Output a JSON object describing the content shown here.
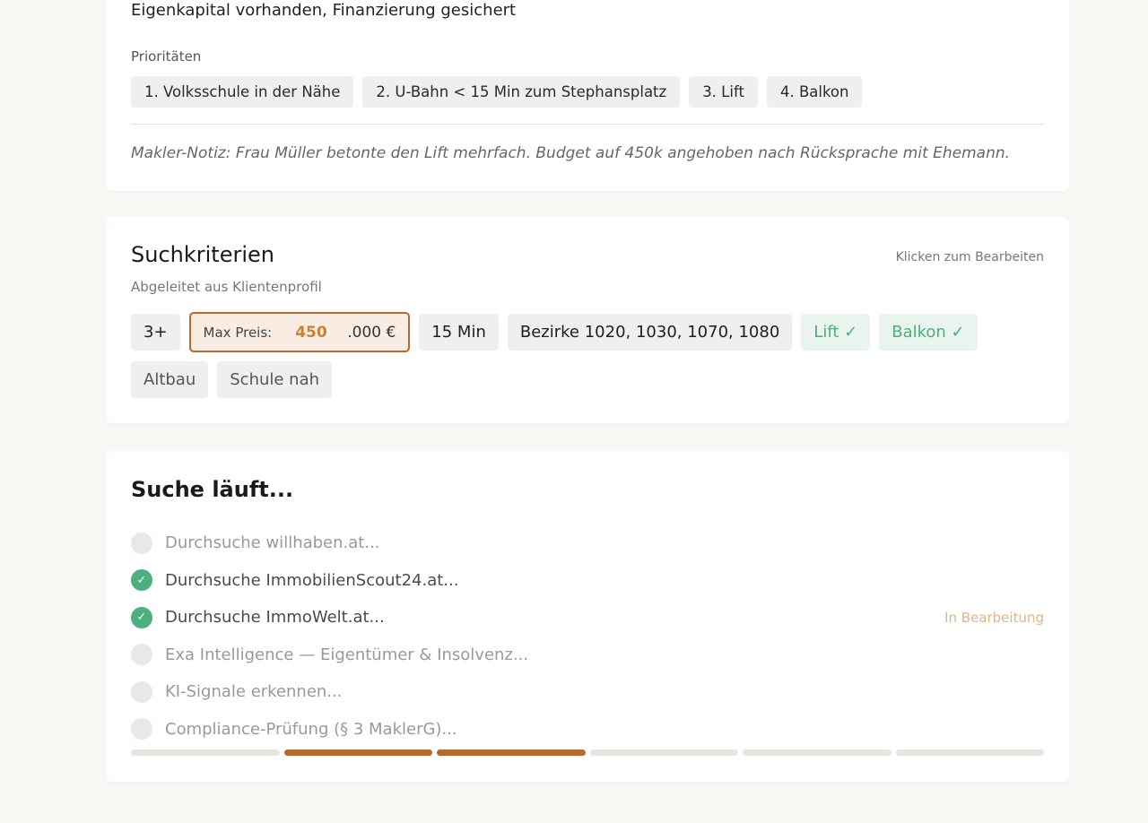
{
  "profile": {
    "finance_line": "Eigenkapital vorhanden, Finanzierung gesichert",
    "priorities_label": "Prioritäten",
    "priorities": [
      "1. Volksschule in der Nähe",
      "2. U-Bahn < 15 Min zum Stephansplatz",
      "3. Lift",
      "4. Balkon"
    ],
    "note": "Makler-Notiz: Frau Müller betonte den Lift mehrfach. Budget auf 450k angehoben nach Rücksprache mit Ehemann."
  },
  "criteria": {
    "title": "Suchkriterien",
    "edit_hint": "Klicken zum Bearbeiten",
    "subtitle": "Abgeleitet aus Klientenprofil",
    "rooms": "3+",
    "price_label": "Max Preis:",
    "price_value": "450",
    "price_suffix": ".000 €",
    "commute": "15 Min",
    "districts": "Bezirke 1020, 1030, 1070, 1080",
    "lift": "Lift ✓",
    "balcony": "Balkon ✓",
    "altbau": "Altbau",
    "school": "Schule nah",
    "colors": {
      "accent": "#b86a2c",
      "success": "#4caf7d"
    }
  },
  "search": {
    "title": "Suche läuft...",
    "steps": [
      {
        "label": "Durchsuche willhaben.at...",
        "done": false,
        "status": ""
      },
      {
        "label": "Durchsuche ImmobilienScout24.at...",
        "done": true,
        "status": ""
      },
      {
        "label": "Durchsuche ImmoWelt.at...",
        "done": true,
        "status": "In Bearbeitung"
      },
      {
        "label": "Exa Intelligence — Eigentümer & Insolvenz...",
        "done": false,
        "status": ""
      },
      {
        "label": "KI-Signale erkennen...",
        "done": false,
        "status": ""
      },
      {
        "label": "Compliance-Prüfung (§ 3 MaklerG)...",
        "done": false,
        "status": ""
      }
    ],
    "check_icon": "✓",
    "progress_segments": [
      false,
      true,
      true,
      false,
      false,
      false
    ]
  }
}
